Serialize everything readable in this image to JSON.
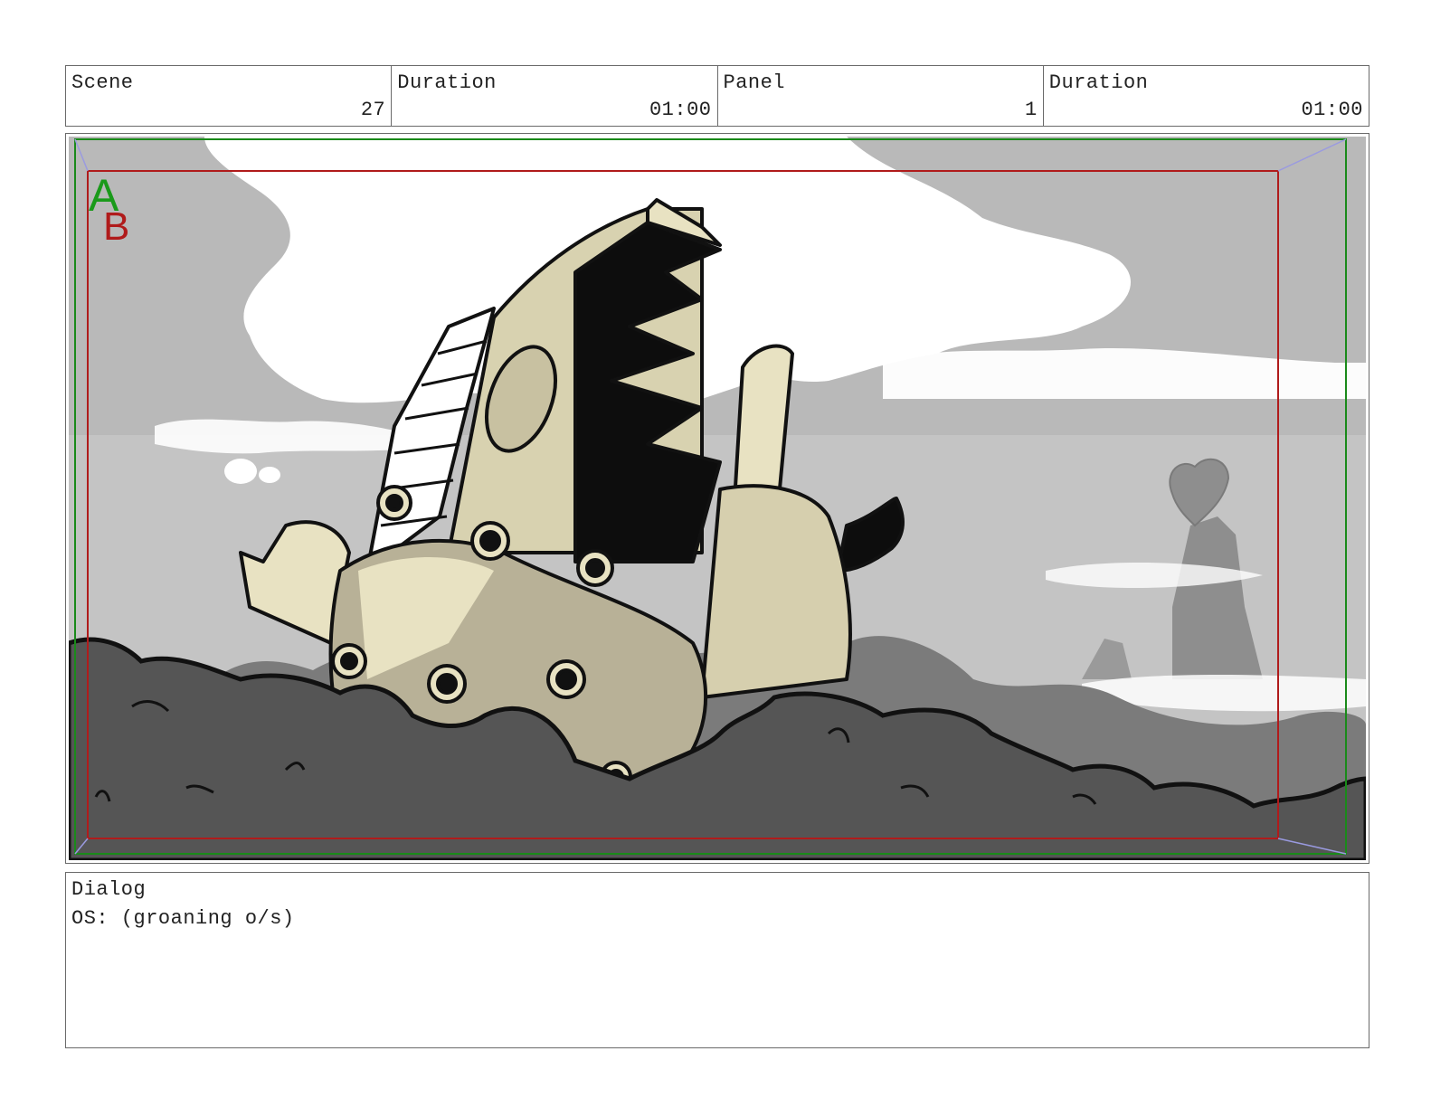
{
  "header": {
    "scene_label": "Scene",
    "scene_value": "27",
    "scene_duration_label": "Duration",
    "scene_duration_value": "01:00",
    "panel_label": "Panel",
    "panel_value": "1",
    "panel_duration_label": "Duration",
    "panel_duration_value": "01:00"
  },
  "panel": {
    "safe_area_a_label": "A",
    "safe_area_b_label": "B",
    "colors": {
      "frame_a": "#1a8a1a",
      "frame_b": "#b01b1b",
      "sky": "#c9c9c9",
      "cloud": "#ffffff",
      "rubble": "#4e4e4e",
      "robot_light": "#e8e2c2",
      "robot_shade": "#b8b197"
    }
  },
  "dialog": {
    "label": "Dialog",
    "text": "OS: (groaning o/s)"
  }
}
